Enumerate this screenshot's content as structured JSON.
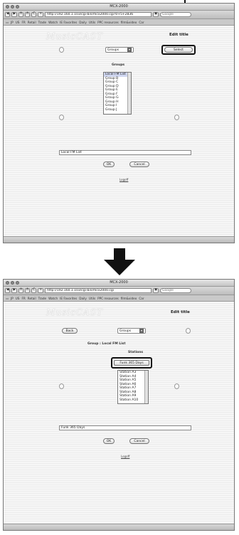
{
  "windows": [
    {
      "title": "MCX-2000",
      "url": "http://192.160.1.103/cgi-bin/mcx2000.cgi?0+5+2836",
      "search_placeholder": "Google",
      "bookmarks": [
        "JP",
        "US",
        "FR",
        "Retail",
        "Trade",
        "Watch",
        "IE Favorites",
        "Daily",
        "Utils",
        "PPC resources",
        "film&video",
        "Car"
      ],
      "page_title": "Edit title",
      "logo": "MusicCAST",
      "groups_select": "Groups",
      "select_button": "Select",
      "list_label": "Groups",
      "list_items": [
        "Local FM List",
        "Group B",
        "Group C",
        "Group D",
        "Group E",
        "Group F",
        "Group G",
        "Group H",
        "Group I",
        "Group J"
      ],
      "text_value": "Local FM List",
      "ok": "OK",
      "cancel": "Cancel",
      "logoff": "Logoff"
    },
    {
      "title": "MCX-2000",
      "url": "http://192.160.1.103/cgi-bin/mcx2000.cgi",
      "search_placeholder": "Google",
      "bookmarks": [
        "JP",
        "US",
        "FR",
        "Retail",
        "Trade",
        "Watch",
        "IE Favorites",
        "Daily",
        "Utils",
        "PPC resources",
        "film&video",
        "Car"
      ],
      "page_title": "Edit title",
      "logo": "MusicCAST",
      "back": "Back",
      "groups_select": "Groups",
      "group_caption": "Group : Local FM List",
      "list_label": "Stations",
      "highlight_item": "Funk 365 Days",
      "list_items": [
        "Station A3",
        "Station A4",
        "Station A5",
        "Station A6",
        "Station A7",
        "Station A8",
        "Station A9",
        "Station A10"
      ],
      "text_value": "Funk 365 Days",
      "ok": "OK",
      "cancel": "Cancel",
      "logoff": "Logoff"
    }
  ]
}
